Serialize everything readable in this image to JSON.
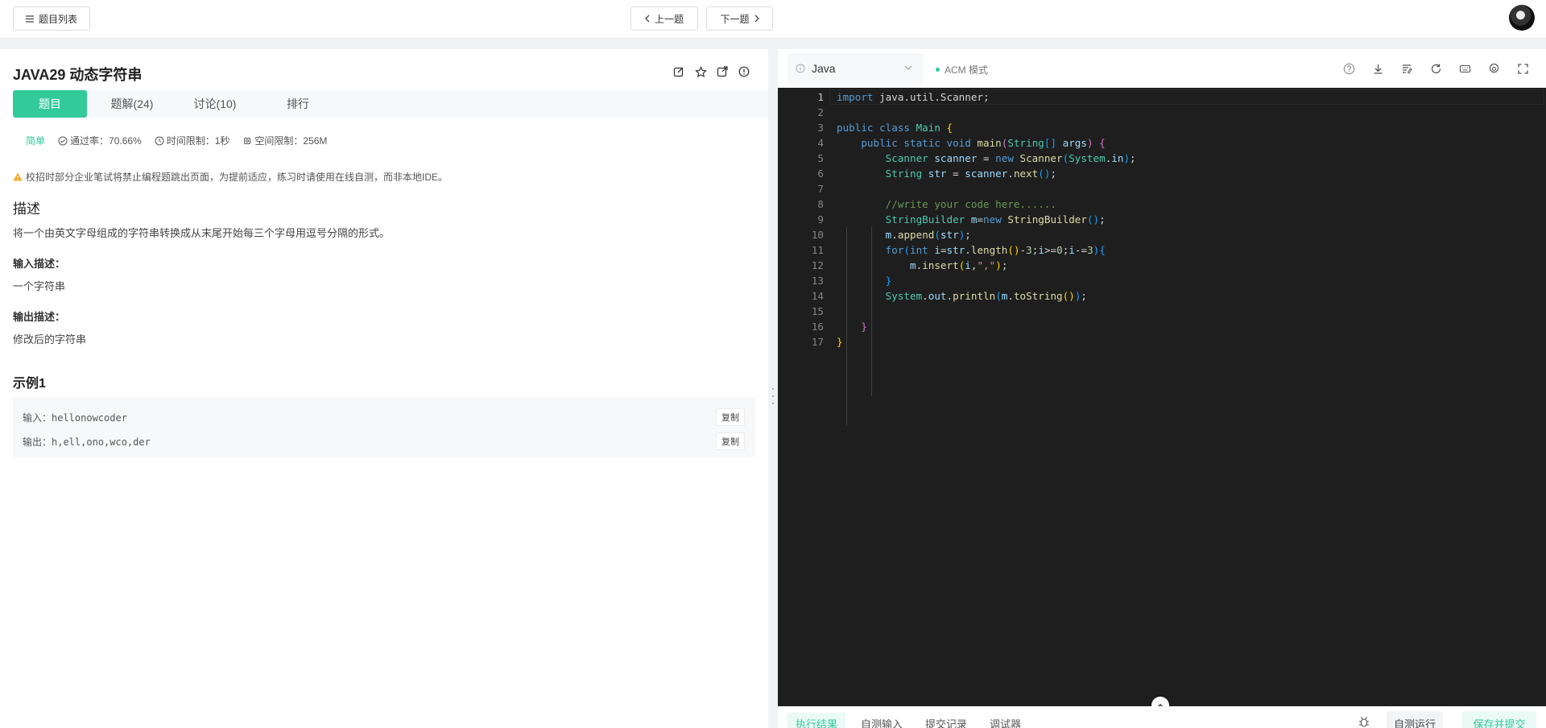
{
  "topbar": {
    "problem_list_label": "题目列表",
    "prev_label": "上一题",
    "next_label": "下一题"
  },
  "problem": {
    "title": "JAVA29  动态字符串",
    "tabs": [
      {
        "label": "题目"
      },
      {
        "label": "题解(24)"
      },
      {
        "label": "讨论(10)"
      },
      {
        "label": "排行"
      }
    ],
    "difficulty": "简单",
    "pass_rate": "通过率：70.66%",
    "time_limit": "时间限制：1秒",
    "space_limit": "空间限制：256M",
    "warning": "校招时部分企业笔试将禁止编程题跳出页面，为提前适应，练习时请使用在线自测，而非本地IDE。",
    "desc_heading": "描述",
    "desc_text": "将一个由英文字母组成的字符串转换成从末尾开始每三个字母用逗号分隔的形式。",
    "input_heading": "输入描述：",
    "input_text": "一个字符串",
    "output_heading": "输出描述：",
    "output_text": "修改后的字符串",
    "example_heading": "示例1",
    "example_input": "输入：hellonowcoder",
    "example_output": "输出：h,ell,ono,wco,der",
    "copy_label": "复制"
  },
  "editor": {
    "language": "Java",
    "mode": "ACM 模式",
    "line_numbers": [
      "1",
      "2",
      "3",
      "4",
      "5",
      "6",
      "7",
      "8",
      "9",
      "10",
      "11",
      "12",
      "13",
      "14",
      "15",
      "16",
      "17"
    ]
  },
  "bottom": {
    "tabs": [
      {
        "label": "执行结果"
      },
      {
        "label": "自测输入"
      },
      {
        "label": "提交记录"
      },
      {
        "label": "调试器"
      }
    ],
    "self_test_label": "自测运行",
    "submit_label": "保存并提交"
  },
  "colors": {
    "accent": "#32ca99",
    "editor_bg": "#1e1e1e"
  }
}
